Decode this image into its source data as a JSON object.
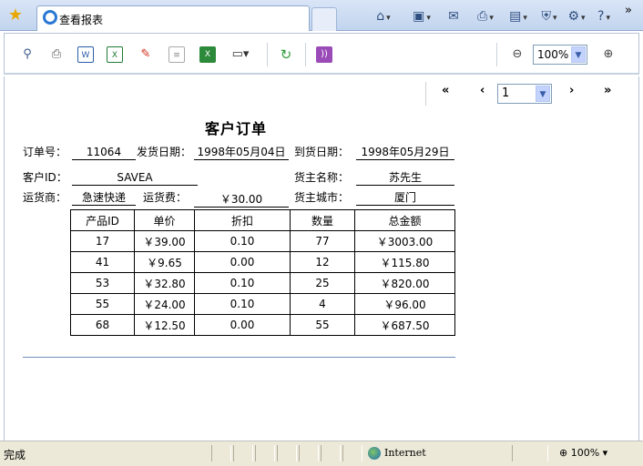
{
  "browser": {
    "tab_title": "查看报表",
    "commands": [
      "home-icon",
      "feeds-icon",
      "read-mail-icon",
      "print-icon",
      "page-icon",
      "safety-icon",
      "tools-icon",
      "help-icon"
    ],
    "chevron": "»"
  },
  "report_toolbar": {
    "zoom_value": "100%",
    "tools": [
      "search-icon",
      "print-icon",
      "export-word-icon",
      "export-excel-icon",
      "export-pdf-icon",
      "export-text-icon",
      "export-csv-icon",
      "display-menu-icon",
      "refresh-icon",
      "rss-icon"
    ]
  },
  "pager": {
    "first": "«",
    "prev": "‹",
    "page_value": "1",
    "next": "›",
    "last": "»"
  },
  "report": {
    "title": "客户订单",
    "order_no_label": "订单号：",
    "order_no": "11064",
    "ship_date_label": "发货日期：",
    "ship_date": "1998年05月04日",
    "arrive_date_label": "到货日期：",
    "arrive_date": "1998年05月29日",
    "customer_id_label": "客户ID：",
    "customer_id": "SAVEA",
    "shipper_label": "运货商：",
    "shipper": "急速快递",
    "freight_label": "运货费：",
    "freight": "￥30.00",
    "consignee_label": "货主名称：",
    "consignee": "苏先生",
    "consignee_city_label": "货主城市：",
    "consignee_city": "厦门",
    "columns": [
      "产品ID",
      "单价",
      "折扣",
      "数量",
      "总金额"
    ],
    "rows": [
      [
        "17",
        "￥39.00",
        "0.10",
        "77",
        "￥3003.00"
      ],
      [
        "41",
        "￥9.65",
        "0.00",
        "12",
        "￥115.80"
      ],
      [
        "53",
        "￥32.80",
        "0.10",
        "25",
        "￥820.00"
      ],
      [
        "55",
        "￥24.00",
        "0.10",
        "4",
        "￥96.00"
      ],
      [
        "68",
        "￥12.50",
        "0.00",
        "55",
        "￥687.50"
      ]
    ]
  },
  "statusbar": {
    "text": "完成",
    "zone": "Internet",
    "zoom": "100%"
  }
}
